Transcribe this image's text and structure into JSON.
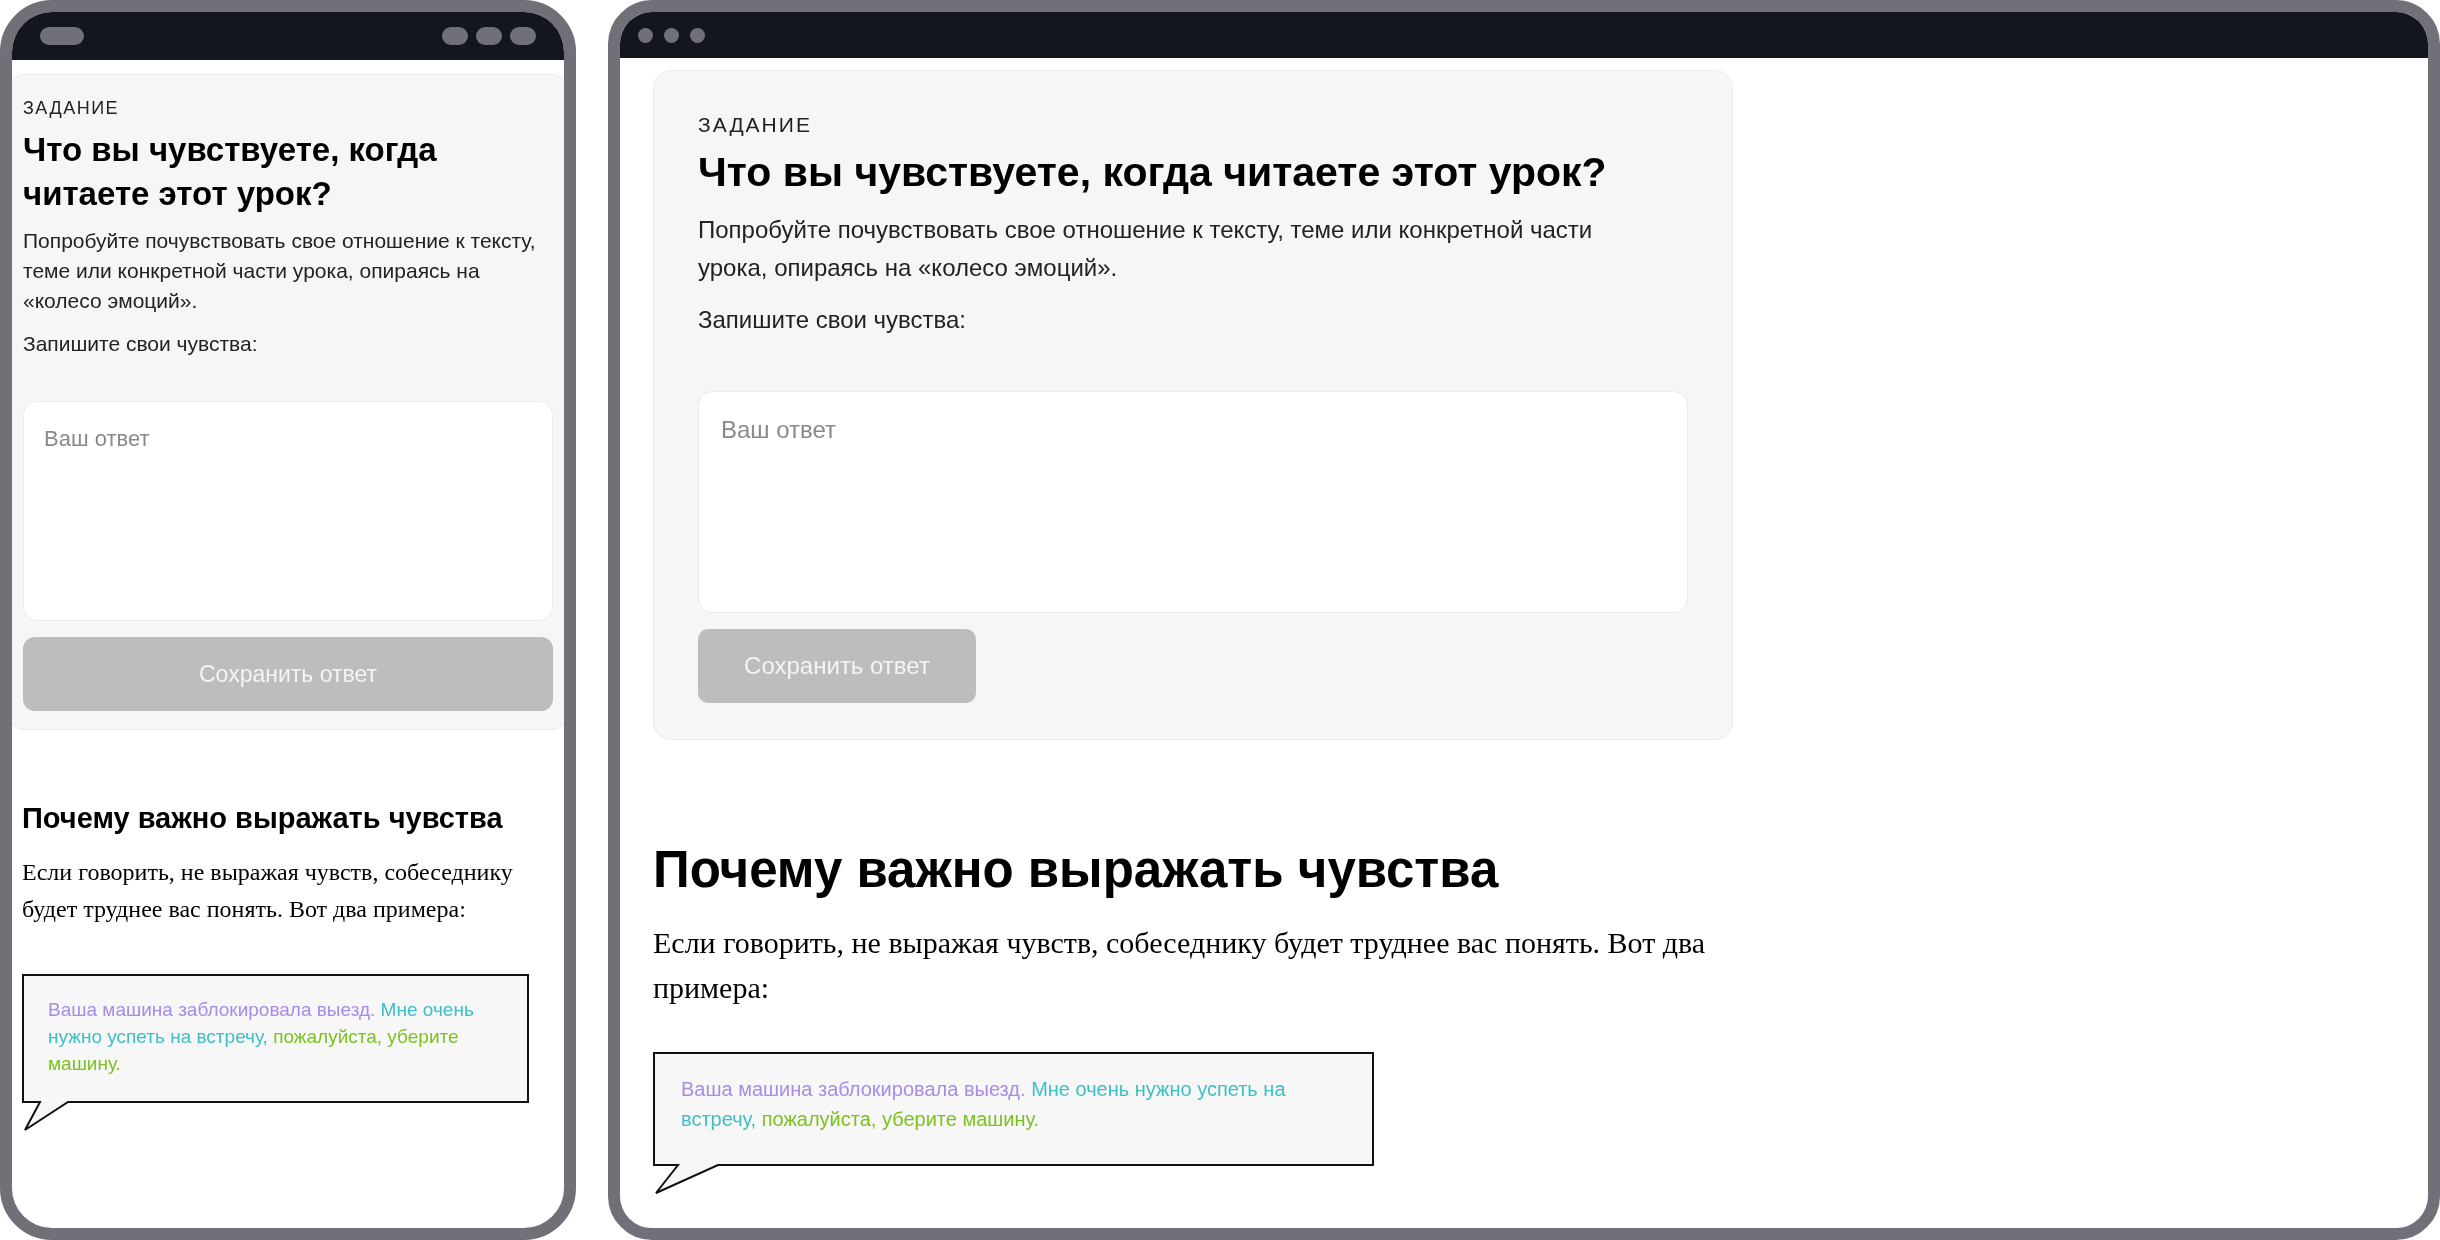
{
  "mobile": {
    "task": {
      "eyebrow": "ЗАДАНИЕ",
      "title": "Что вы чувствуете, когда читаете этот урок?",
      "description": "Попробуйте почувствовать свое отношение к тексту, теме или конкретной части урока, опираясь на «колесо эмоций».",
      "prompt": "Запишите свои чувства:",
      "answer": {
        "placeholder": "Ваш ответ"
      },
      "save_button": {
        "label": "Сохранить ответ",
        "disabled": true
      }
    },
    "section": {
      "heading": "Почему важно выражать чувства",
      "paragraph": "Если говорить, не выражая чувств, собеседнику будет труднее вас понять. Вот два примера:",
      "bubble": [
        {
          "text": "Ваша машина заблокировала выезд.",
          "color": "#a98be8"
        },
        {
          "text": "Мне очень нужно успеть на встречу,",
          "color": "#3cbfc6"
        },
        {
          "text": "пожалуйста, уберите машину.",
          "color": "#7cc21f"
        }
      ]
    }
  },
  "desktop": {
    "task": {
      "eyebrow": "ЗАДАНИЕ",
      "title": "Что вы чувствуете, когда читаете этот урок?",
      "description": "Попробуйте почувствовать свое отношение к тексту, теме или конкретной части урока, опираясь на «колесо эмоций».",
      "prompt": "Запишите свои чувства:",
      "answer": {
        "placeholder": "Ваш ответ"
      },
      "save_button": {
        "label": "Сохранить ответ",
        "disabled": true
      }
    },
    "section": {
      "heading": "Почему важно выражать чувства",
      "paragraph": "Если говорить, не выражая чувств, собеседнику будет труднее вас понять. Вот два примера:",
      "bubble": [
        {
          "text": "Ваша машина заблокировала выезд.",
          "color": "#a98be8"
        },
        {
          "text": "Мне очень нужно успеть на встречу,",
          "color": "#3cbfc6"
        },
        {
          "text": "пожалуйста, уберите машину.",
          "color": "#7cc21f"
        }
      ]
    }
  }
}
